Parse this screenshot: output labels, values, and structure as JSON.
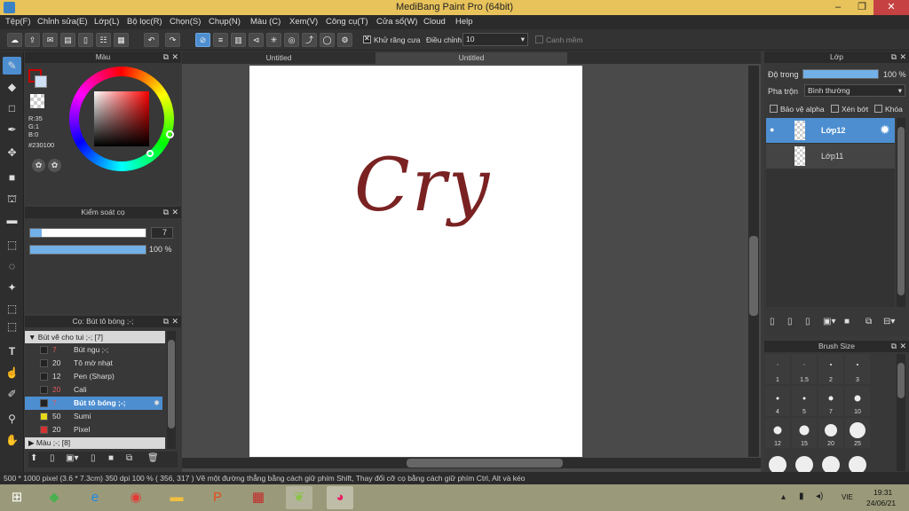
{
  "window": {
    "title": "MediBang Paint Pro (64bit)",
    "min": "–",
    "max": "❐",
    "close": "✕"
  },
  "menu": [
    "Tệp(F)",
    "Chỉnh sửa(E)",
    "Lớp(L)",
    "Bộ lọc(R)",
    "Chọn(S)",
    "Chụp(N)",
    "Màu (C)",
    "Xem(V)",
    "Công cụ(T)",
    "Cửa sổ(W)",
    "Cloud",
    "Help"
  ],
  "toolbar": {
    "antialias_label": "Khử răng cưa",
    "adjust_label": "Điều chỉnh",
    "adjust_value": "10",
    "snap_label": "Canh mềm"
  },
  "color_panel": {
    "title": "Màu",
    "r": "R:35",
    "g": "G:1",
    "b": "B:0",
    "hex": "#230100",
    "fg_color": "#230100",
    "bg_color": "#ffffff"
  },
  "brush_control": {
    "title": "Kiểm soát cọ",
    "size": "7",
    "opacity": "100 %",
    "opacity_fraction": 1.0,
    "size_fraction": 0.1
  },
  "brush_panel": {
    "title": "Cọ: Bút tô bóng ;-;",
    "group1": "Bút vẽ cho tui ;-; [7]",
    "items": [
      {
        "size": "7",
        "name": "Bút ngu ;-;",
        "color": "#222222"
      },
      {
        "size": "20",
        "name": "Tô mờ nhạt",
        "color": "#222222"
      },
      {
        "size": "12",
        "name": "Pen (Sharp)",
        "color": "#222222"
      },
      {
        "size": "20",
        "name": "Cali",
        "color": "#222222"
      },
      {
        "size": "7",
        "name": "Bút tô bóng ;-;",
        "color": "#222222"
      },
      {
        "size": "50",
        "name": "Sumi",
        "color": "#e8d81c"
      },
      {
        "size": "20",
        "name": "Pixel",
        "color": "#d83030"
      }
    ],
    "group2": "Màu ;-; [8]"
  },
  "tabs": [
    "Untitled",
    "Untitled"
  ],
  "canvas_text": "Cry",
  "layer_panel": {
    "title": "Lớp",
    "opacity_label": "Độ trong",
    "opacity_value": "100 %",
    "blend_label": "Pha trộn",
    "blend_value": "Bình thường",
    "protect_alpha": "Bảo vệ alpha",
    "clip": "Xén bớt",
    "lock": "Khóa",
    "layers": [
      "Lớp12",
      "Lớp11"
    ]
  },
  "brush_size": {
    "title": "Brush Size",
    "sizes": [
      "1",
      "1.5",
      "2",
      "3",
      "4",
      "5",
      "7",
      "10",
      "12",
      "15",
      "20",
      "25"
    ]
  },
  "status": "500 * 1000 pixel   (3.6 * 7.3cm)   350 dpi   100 %   ( 356, 317 )   Vẽ một đường thẳng bằng cách giữ phím Shift, Thay đổi cỡ cọ bằng cách giữ phím Ctrl, Alt và kéo",
  "taskbar": {
    "lang": "VIE",
    "time": "19:31",
    "date": "24/06/21"
  }
}
